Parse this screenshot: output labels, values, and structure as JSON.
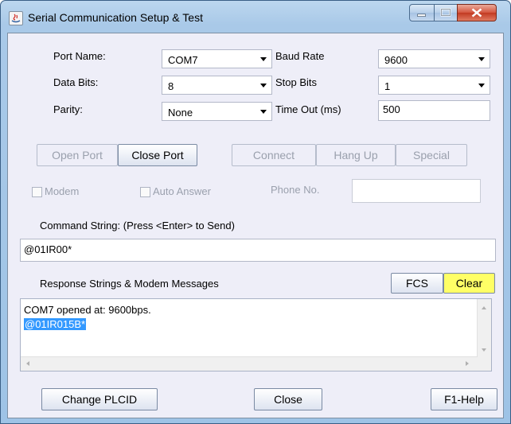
{
  "window": {
    "title": "Serial Communication Setup & Test"
  },
  "port": {
    "port_name_label": "Port Name:",
    "port_name_value": "COM7",
    "baud_label": "Baud Rate",
    "baud_value": "9600",
    "data_bits_label": "Data Bits:",
    "data_bits_value": "8",
    "stop_bits_label": "Stop Bits",
    "stop_bits_value": "1",
    "parity_label": "Parity:",
    "parity_value": "None",
    "timeout_label": "Time Out (ms)",
    "timeout_value": "500"
  },
  "buttons": {
    "open_port": "Open Port",
    "close_port": "Close Port",
    "connect": "Connect",
    "hang_up": "Hang Up",
    "special": "Special",
    "fcs": "FCS",
    "clear": "Clear",
    "change_plcid": "Change PLCID",
    "close": "Close",
    "help": "F1-Help"
  },
  "modem": {
    "modem_label": "Modem",
    "auto_answer_label": "Auto Answer",
    "phone_label": "Phone No.",
    "phone_value": ""
  },
  "command": {
    "label": "Command String: (Press <Enter> to Send)",
    "value": "@01IR00*"
  },
  "response": {
    "label": "Response Strings & Modem Messages",
    "lines": [
      "COM7 opened at: 9600bps.",
      "@01IR015B*"
    ]
  },
  "colors": {
    "clear_button_bg": "#ffff66",
    "selection_bg": "#3399ff"
  }
}
